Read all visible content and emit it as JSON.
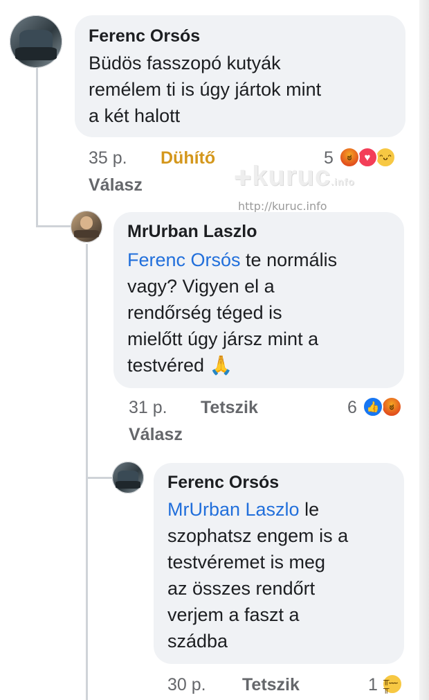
{
  "comments": [
    {
      "author": "Ferenc Orsós",
      "lines": [
        "Büdös fasszopó kutyák",
        "remélem ti is úgy jártok mint",
        "a két halott"
      ],
      "time": "35 p.",
      "action": "Dühítő",
      "reply": "Válasz",
      "reaction_count": "5",
      "reactions": [
        "angry-reaction-icon",
        "love-reaction-icon",
        "haha-reaction-icon"
      ]
    },
    {
      "author": "MrUrban Laszlo",
      "mention": "Ferenc Orsós",
      "first_line_rest": " te normális",
      "lines": [
        "vagy? Vigyen el a",
        "rendőrség téged is",
        "mielőtt úgy jársz mint a",
        "testvéred 🙏"
      ],
      "time": "31 p.",
      "action": "Tetszik",
      "reply": "Válasz",
      "reaction_count": "6",
      "reactions": [
        "like-reaction-icon",
        "angry-reaction-icon"
      ]
    },
    {
      "author": "Ferenc Orsós",
      "mention": "MrUrban Laszlo",
      "first_line_rest": " le",
      "lines": [
        "szophatsz engem is a",
        "testvéremet is meg",
        "az összes rendőrt",
        "verjem a faszt a",
        "szádba"
      ],
      "time": "30 p.",
      "action": "Tetszik",
      "reaction_count": "1",
      "reactions": [
        "sad-reaction-icon"
      ]
    }
  ],
  "watermark": {
    "logo": "kuruc",
    "url": "http://kuruc.info"
  }
}
